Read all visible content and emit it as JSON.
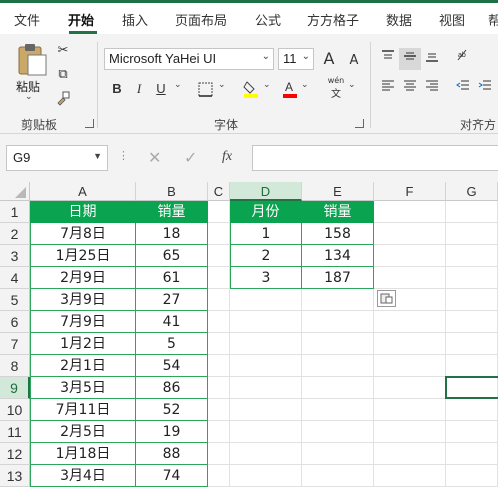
{
  "ribbon_tabs": [
    "文件",
    "开始",
    "插入",
    "页面布局",
    "公式",
    "方方格子",
    "数据",
    "视图",
    "帮"
  ],
  "active_tab": "开始",
  "clipboard": {
    "paste_label": "粘贴",
    "group_label": "剪贴板"
  },
  "font": {
    "name": "Microsoft YaHei UI",
    "size": "11",
    "group_label": "字体",
    "bold": "B",
    "italic": "I",
    "underline": "U",
    "grow": "A",
    "shrink": "A",
    "phonetic_top": "wén",
    "phonetic_bottom": "文",
    "underline_color": "#0066cc",
    "fill_color": "#ffff00",
    "font_color": "#ff0000"
  },
  "alignment": {
    "group_label": "对齐方"
  },
  "formula_bar": {
    "name_box": "G9",
    "fx": "fx",
    "content": ""
  },
  "columns": [
    "A",
    "B",
    "C",
    "D",
    "E",
    "F",
    "G"
  ],
  "selected_column": "D",
  "rows": [
    "1",
    "2",
    "3",
    "4",
    "5",
    "6",
    "7",
    "8",
    "9",
    "10",
    "11",
    "12",
    "13"
  ],
  "selected_row": "9",
  "table1": {
    "headers": [
      "日期",
      "销量"
    ],
    "rows": [
      [
        "7月8日",
        "18"
      ],
      [
        "1月25日",
        "65"
      ],
      [
        "2月9日",
        "61"
      ],
      [
        "3月9日",
        "27"
      ],
      [
        "7月9日",
        "41"
      ],
      [
        "1月2日",
        "5"
      ],
      [
        "2月1日",
        "54"
      ],
      [
        "3月5日",
        "86"
      ],
      [
        "7月11日",
        "52"
      ],
      [
        "2月5日",
        "19"
      ],
      [
        "1月18日",
        "88"
      ],
      [
        "3月4日",
        "74"
      ]
    ]
  },
  "table2": {
    "headers": [
      "月份",
      "销量"
    ],
    "rows": [
      [
        "1",
        "158"
      ],
      [
        "2",
        "134"
      ],
      [
        "3",
        "187"
      ]
    ]
  },
  "colors": {
    "accent": "#217346",
    "header_fill": "#0aa34f"
  }
}
